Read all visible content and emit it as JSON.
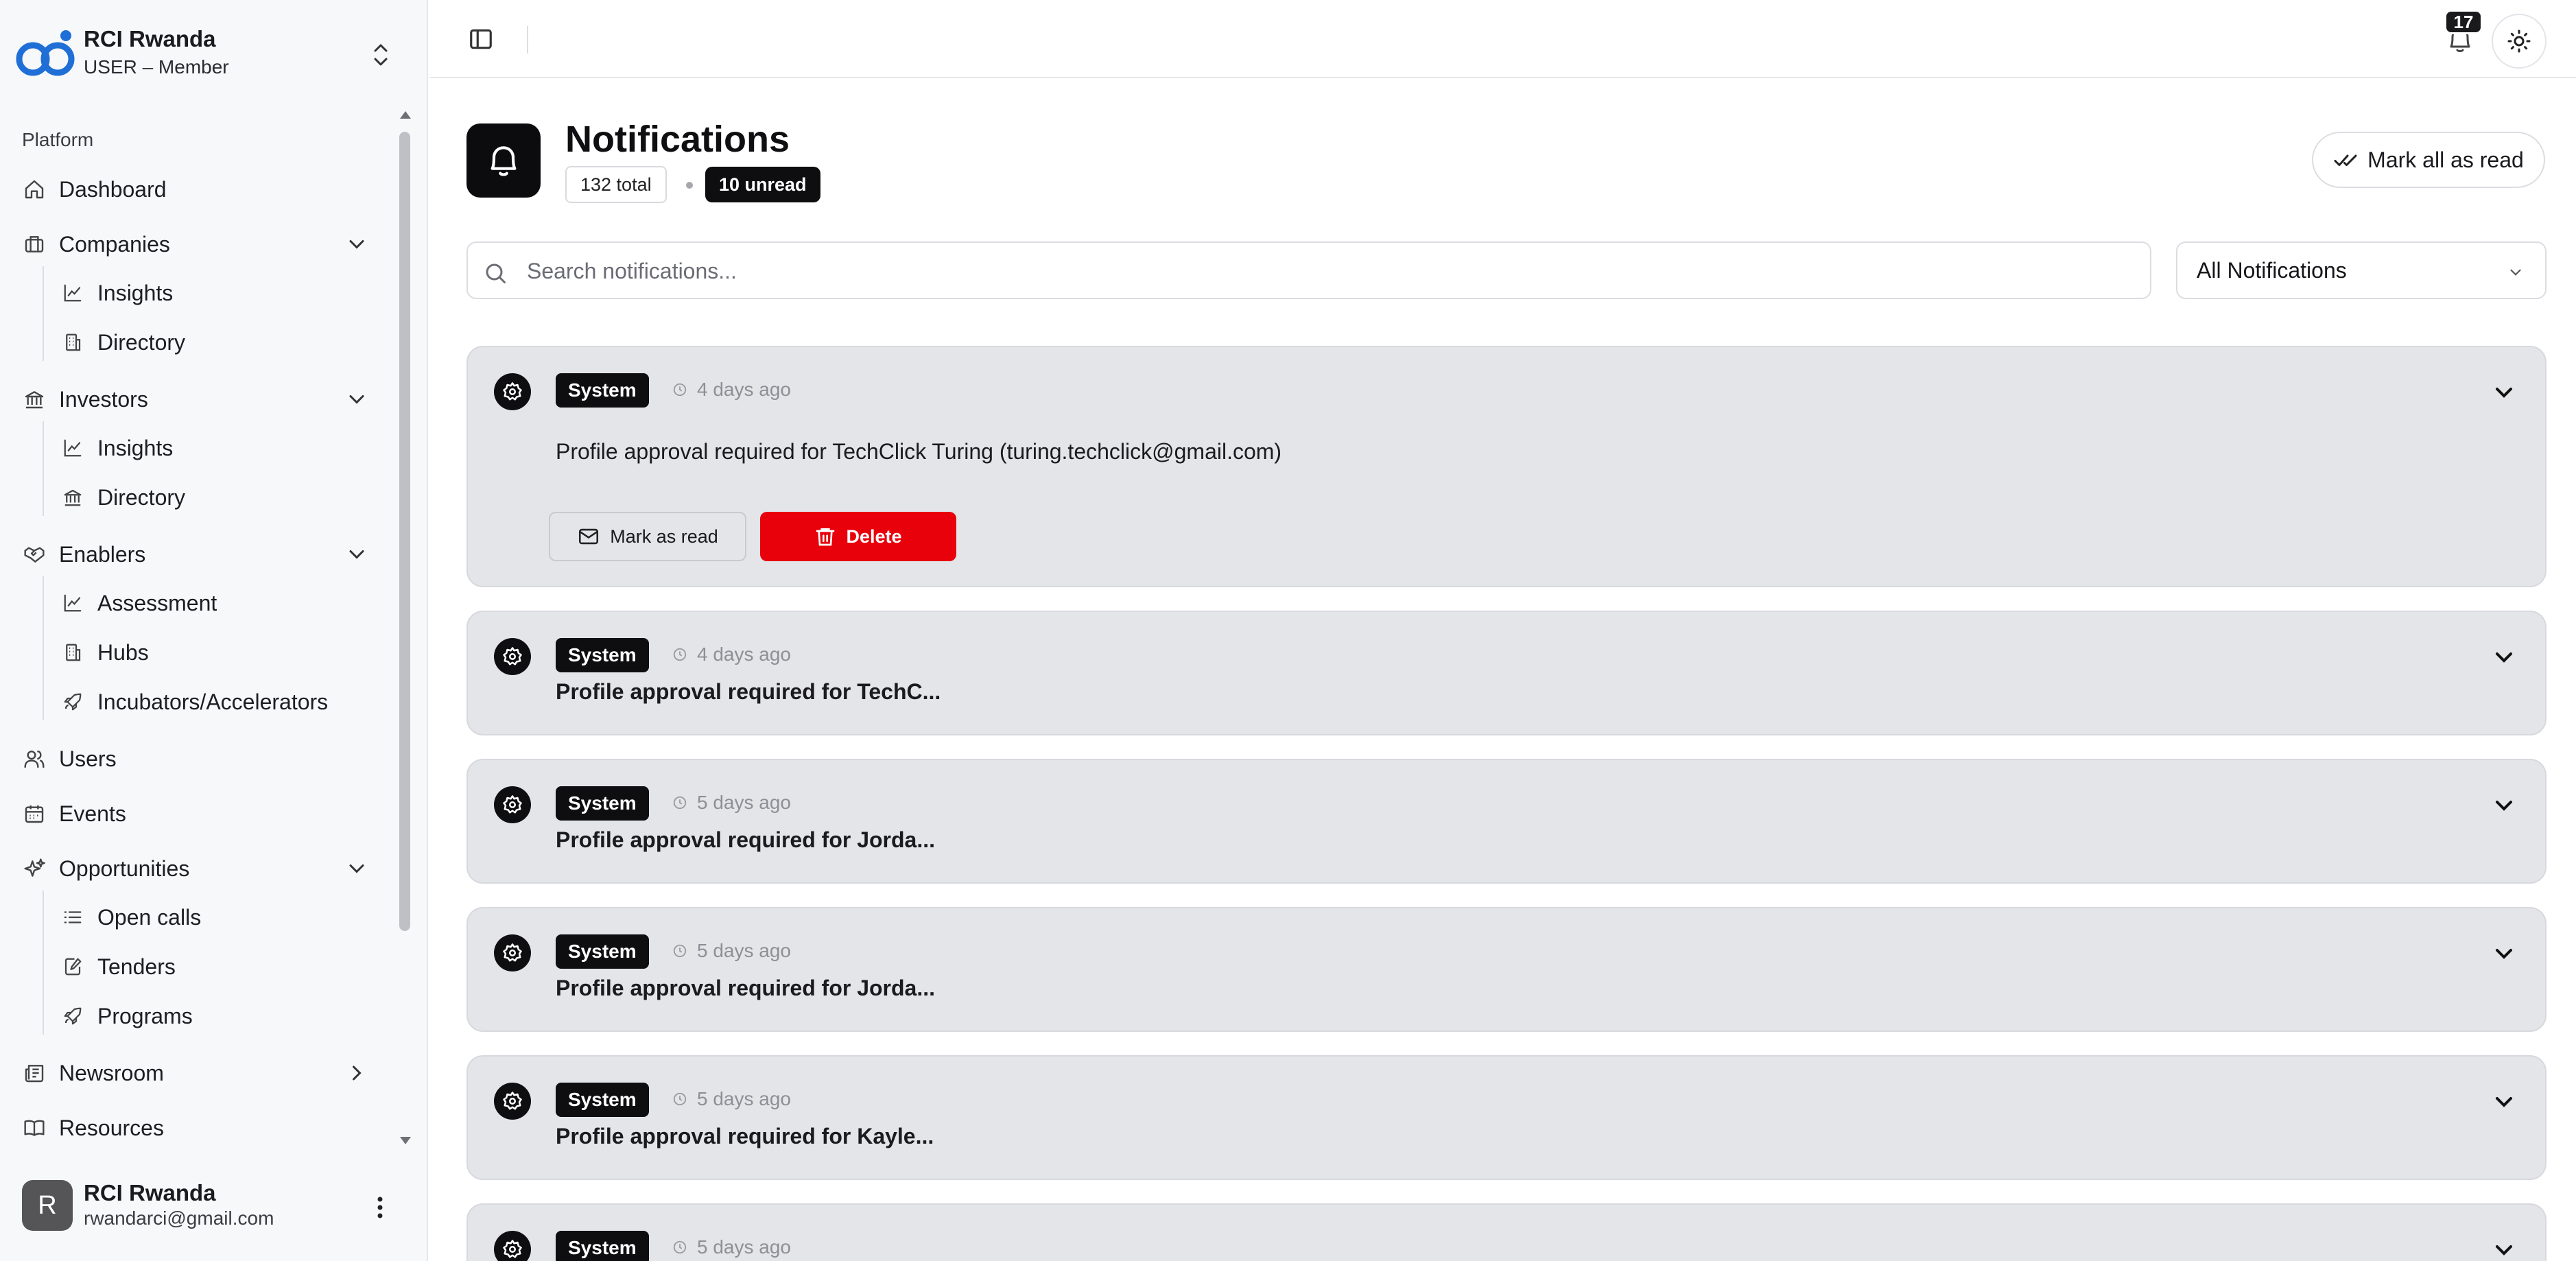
{
  "org": {
    "name": "RCI Rwanda",
    "role": "USER – Member"
  },
  "sidebar": {
    "group_label": "Platform",
    "items": [
      {
        "label": "Dashboard",
        "icon": "home-icon"
      },
      {
        "label": "Companies",
        "icon": "briefcase-icon",
        "sub": [
          {
            "label": "Insights",
            "icon": "chart-line-icon"
          },
          {
            "label": "Directory",
            "icon": "building-icon"
          }
        ]
      },
      {
        "label": "Investors",
        "icon": "landmark-icon",
        "sub": [
          {
            "label": "Insights",
            "icon": "chart-line-icon"
          },
          {
            "label": "Directory",
            "icon": "landmark-icon"
          }
        ]
      },
      {
        "label": "Enablers",
        "icon": "handshake-icon",
        "sub": [
          {
            "label": "Assessment",
            "icon": "chart-line-icon"
          },
          {
            "label": "Hubs",
            "icon": "building-icon"
          },
          {
            "label": "Incubators/Accelerators",
            "icon": "rocket-icon"
          }
        ]
      },
      {
        "label": "Users",
        "icon": "users-icon"
      },
      {
        "label": "Events",
        "icon": "calendar-icon"
      },
      {
        "label": "Opportunities",
        "icon": "sparkles-icon",
        "sub": [
          {
            "label": "Open calls",
            "icon": "list-icon"
          },
          {
            "label": "Tenders",
            "icon": "file-edit-icon"
          },
          {
            "label": "Programs",
            "icon": "rocket-icon"
          }
        ]
      },
      {
        "label": "Newsroom",
        "icon": "newspaper-icon"
      },
      {
        "label": "Resources",
        "icon": "book-icon"
      }
    ]
  },
  "user": {
    "initial": "R",
    "name": "RCI Rwanda",
    "email": "rwandarci@gmail.com"
  },
  "topbar": {
    "notification_count": "17"
  },
  "page": {
    "title": "Notifications",
    "total_label": "132 total",
    "unread_label": "10 unread",
    "mark_all_label": "Mark all as read",
    "search_placeholder": "Search notifications...",
    "filter_value": "All Notifications"
  },
  "notifications": [
    {
      "badge": "System",
      "time": "4 days ago",
      "message": "Profile approval required for TechClick Turing (turing.techclick@gmail.com)",
      "expanded": true,
      "mark_read_label": "Mark as read",
      "delete_label": "Delete"
    },
    {
      "badge": "System",
      "time": "4 days ago",
      "message": "Profile approval required for TechC..."
    },
    {
      "badge": "System",
      "time": "5 days ago",
      "message": "Profile approval required for Jorda..."
    },
    {
      "badge": "System",
      "time": "5 days ago",
      "message": "Profile approval required for Jorda..."
    },
    {
      "badge": "System",
      "time": "5 days ago",
      "message": "Profile approval required for Kayle..."
    },
    {
      "badge": "System",
      "time": "5 days ago",
      "message": ""
    }
  ],
  "colors": {
    "delete": "#e8000b",
    "card_bg": "#e4e5e9",
    "accent_dark": "#0e0e11",
    "logo_blue": "#1f6fd6"
  }
}
